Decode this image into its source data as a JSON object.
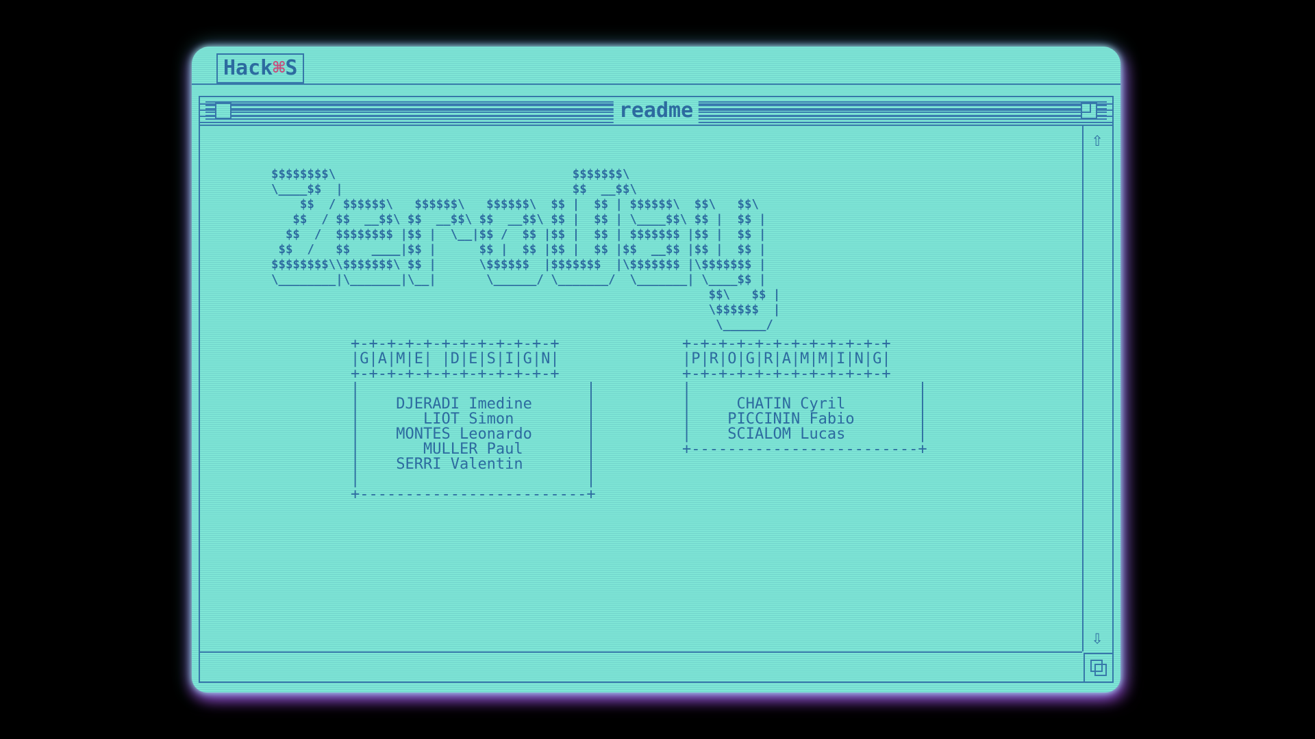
{
  "menubar": {
    "logo_left": "Hack",
    "logo_mark": "⌘",
    "logo_right": "S"
  },
  "window": {
    "title": "readme"
  },
  "banner": {
    "art": "$$$$$$$$\\                                 $$$$$$$\\\n\\____$$  |                                $$  __$$\\\n    $$  / $$$$$$\\   $$$$$$\\   $$$$$$\\  $$ |  $$ | $$$$$$\\  $$\\   $$\\\n   $$  / $$  __$$\\ $$  __$$\\ $$  __$$\\ $$ |  $$ | \\____$$\\ $$ |  $$ |\n  $$  /  $$$$$$$$ |$$ |  \\__|$$ /  $$ |$$ |  $$ | $$$$$$$ |$$ |  $$ |\n $$  /   $$   ____|$$ |      $$ |  $$ |$$ |  $$ |$$  __$$ |$$ |  $$ |\n$$$$$$$$\\\\$$$$$$$\\ $$ |      \\$$$$$$  |$$$$$$$  |\\$$$$$$$ |\\$$$$$$$ |\n\\________|\\_______|\\__|       \\______/ \\_______/  \\_______| \\____$$ |\n                                                             $$\\   $$ |\n                                                             \\$$$$$$  |\n                                                              \\______/"
  },
  "credits": {
    "game_design": {
      "heading": "+-+-+-+-+-+-+-+-+-+-+-+\n|G|A|M|E| |D|E|S|I|G|N|\n+-+-+-+-+-+-+-+-+-+-+-+",
      "names": [
        "DJERADI Imedine",
        "LIOT Simon",
        "MONTES Leonardo",
        "MULLER Paul",
        "SERRI Valentin"
      ]
    },
    "programming": {
      "heading": "+-+-+-+-+-+-+-+-+-+-+-+\n|P|R|O|G|R|A|M|M|I|N|G|\n+-+-+-+-+-+-+-+-+-+-+-+",
      "names": [
        "CHATIN Cyril",
        "PICCININ Fabio",
        "SCIALOM Lucas"
      ]
    }
  },
  "icons": {
    "scroll_up": "⇧",
    "scroll_down": "⇩"
  },
  "colors": {
    "screen_bg": "#7fe6d6",
    "ink": "#2d6aa0",
    "glow": "#c83cff",
    "logo_accent": "#d24a7b"
  }
}
